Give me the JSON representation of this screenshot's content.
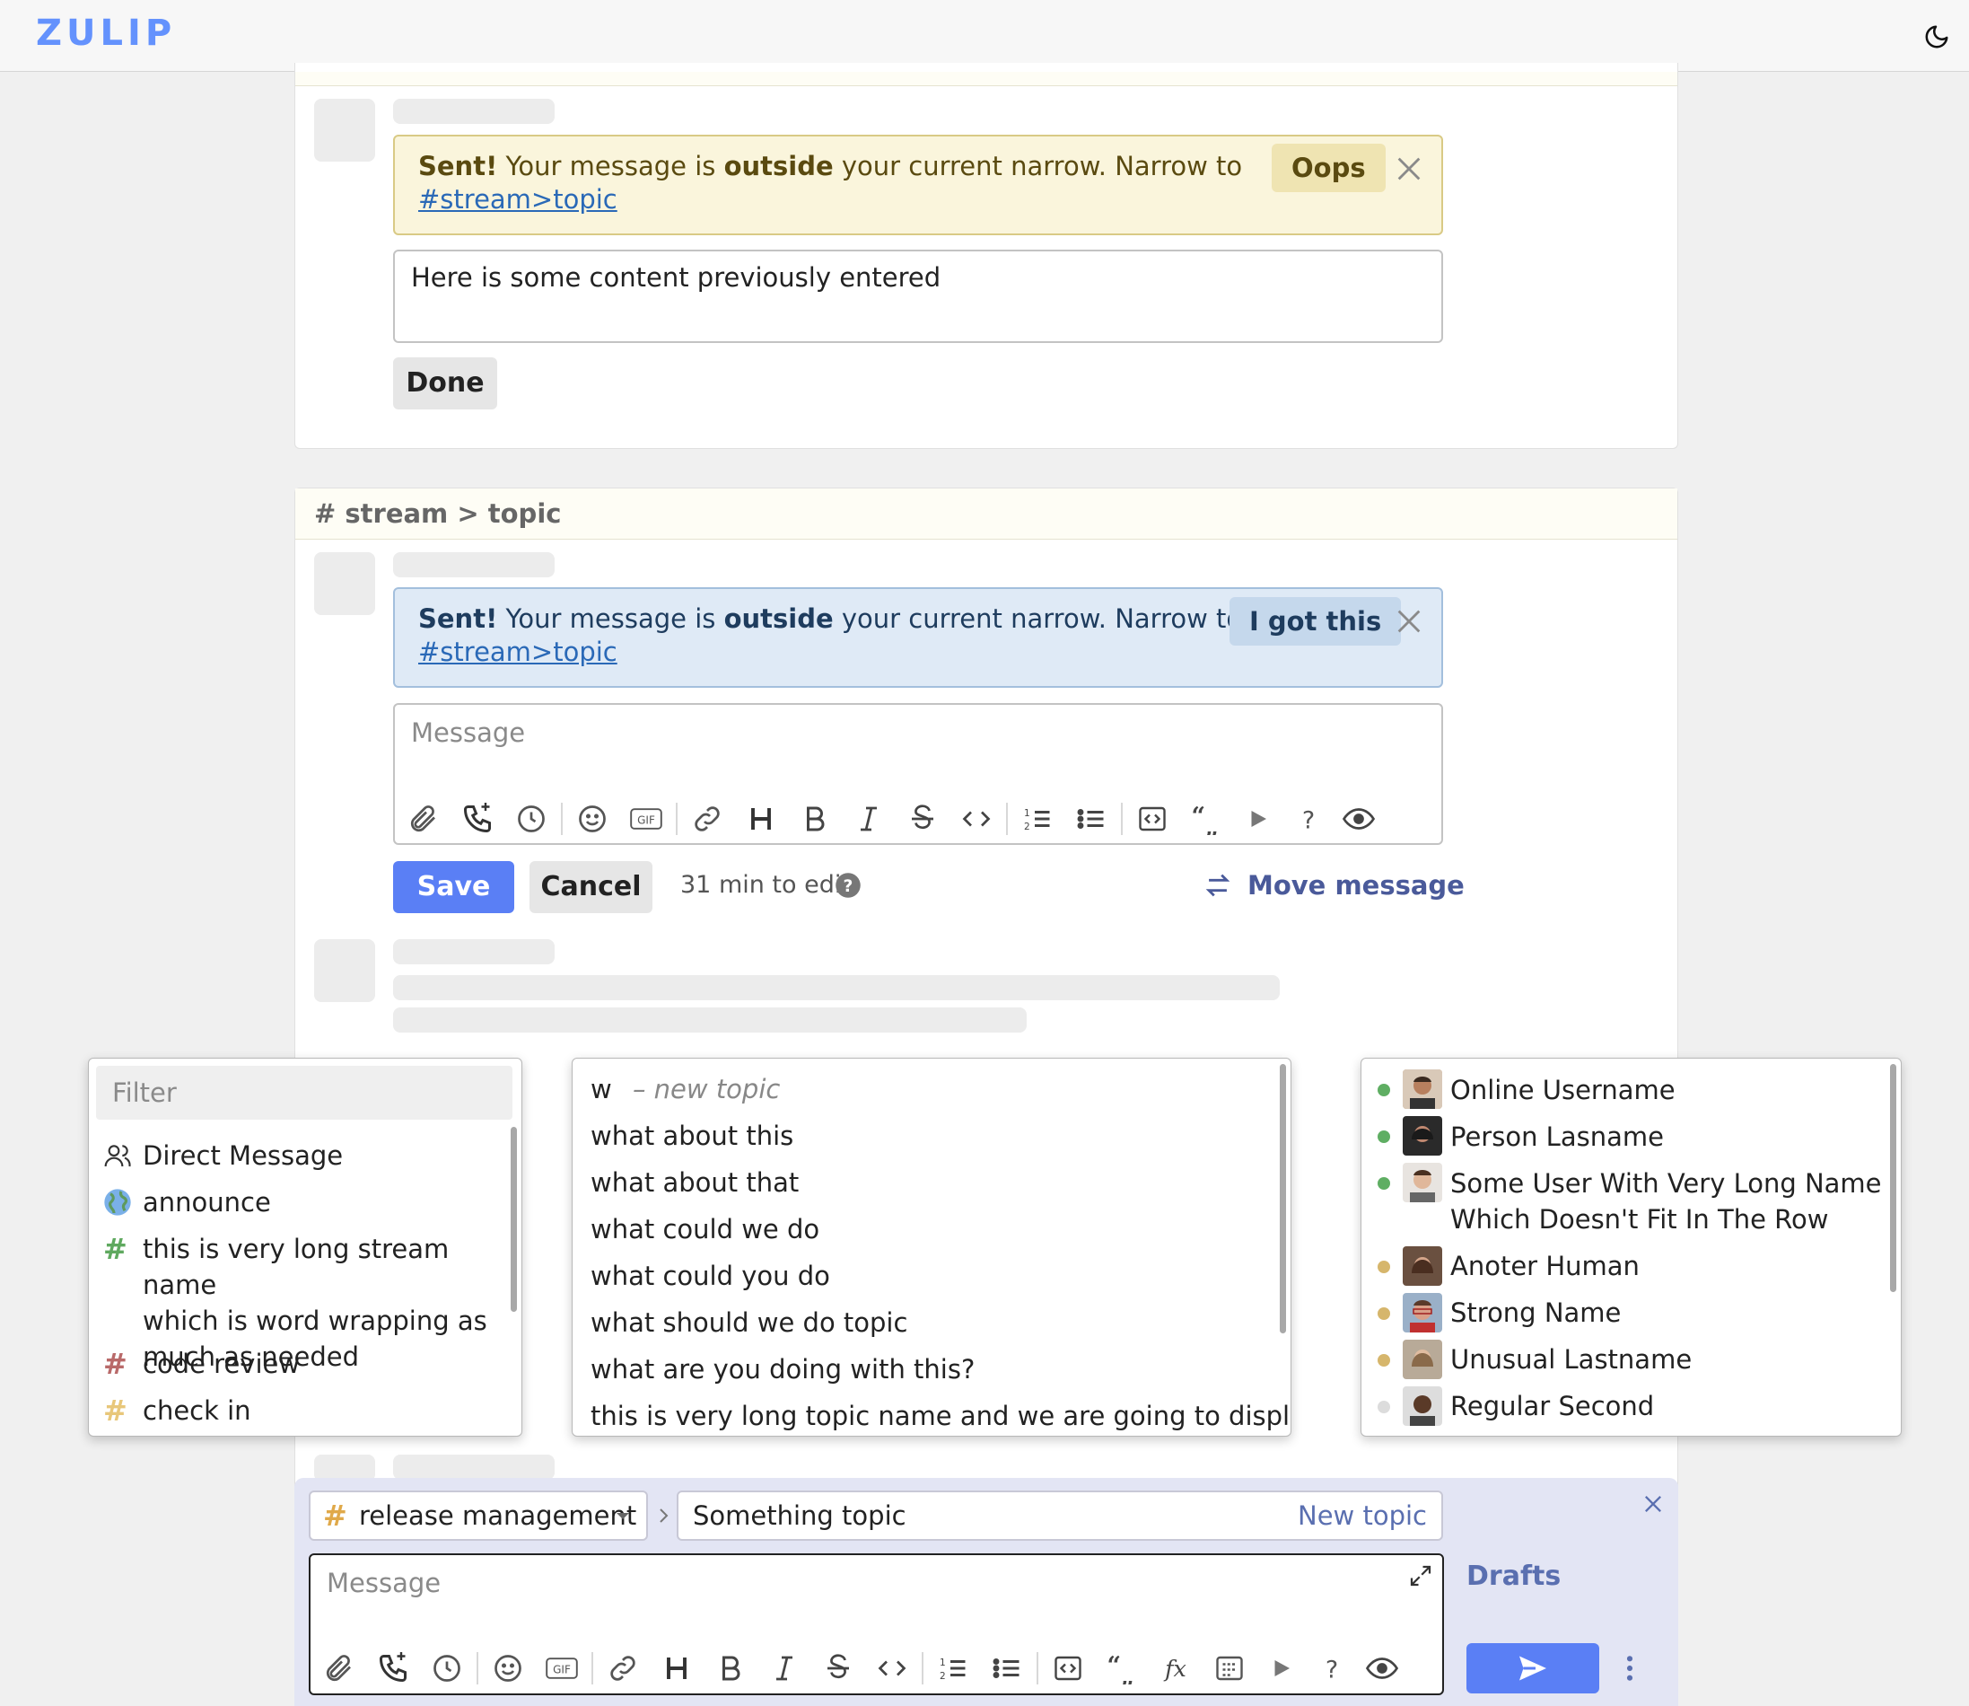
{
  "app": {
    "logo": "ZULIP",
    "theme_icon": "moon-icon"
  },
  "card1": {
    "banner": {
      "bold1": "Sent!",
      "t1": " Your message is ",
      "bold2": "outside",
      "t2": " your current narrow. Narrow to",
      "link": "#stream>topic",
      "action": "Oops"
    },
    "edit_content": "Here is some content previously entered",
    "done": "Done"
  },
  "card2": {
    "header": "# stream > topic",
    "banner": {
      "bold1": "Sent!",
      "t1": " Your message is ",
      "bold2": "outside",
      "t2": " your current narrow. Narrow to",
      "link": "#stream>topic",
      "action": "I got this"
    },
    "message_placeholder": "Message",
    "save": "Save",
    "cancel": "Cancel",
    "time_left": "31 min to edit",
    "move": "Move message"
  },
  "stream_dropdown": {
    "filter_placeholder": "Filter",
    "items": [
      {
        "label": "Direct Message",
        "icon": "users-icon"
      },
      {
        "label": "announce",
        "icon": "globe-icon"
      },
      {
        "line1": "this is very long stream name",
        "line2": "which is word wrapping as",
        "line3": "much as needed",
        "icon": "hash-icon",
        "color": "#5fa95f"
      },
      {
        "label": "code review",
        "icon": "hash-icon",
        "color": "#b96a6a"
      },
      {
        "label": "check in",
        "icon": "hash-icon",
        "color": "#e8c77a"
      }
    ]
  },
  "topic_dropdown": {
    "typed": "w",
    "new_topic_hint": "– new topic",
    "items": [
      "what about this",
      "what about that",
      "what could we do",
      "what could you do",
      "what should we do topic",
      "what are you doing with this?",
      "this is very long topic name and we are going to display all"
    ]
  },
  "user_dropdown": {
    "users": [
      {
        "name": "Online Username",
        "status": "#5fae63"
      },
      {
        "name": "Person Lasname",
        "status": "#5fae63"
      },
      {
        "line1": "Some User With Very Long Name",
        "line2": "Which Doesn't Fit In The Row",
        "status": "#5fae63"
      },
      {
        "name": "Anoter Human",
        "status": "#d6b66c"
      },
      {
        "name": "Strong Name",
        "status": "#d6b66c"
      },
      {
        "name": "Unusual Lastname",
        "status": "#d6b66c"
      },
      {
        "name": "Regular Second",
        "status": "#dcdcdc"
      }
    ]
  },
  "compose": {
    "stream": "release management",
    "topic": "Something topic",
    "new_topic": "New topic",
    "message_placeholder": "Message",
    "drafts": "Drafts"
  },
  "colors": {
    "accent": "#5a7ff5",
    "logo": "#6492fd",
    "warn_bg": "#faf5dc",
    "info_bg": "#dfeaf6"
  }
}
